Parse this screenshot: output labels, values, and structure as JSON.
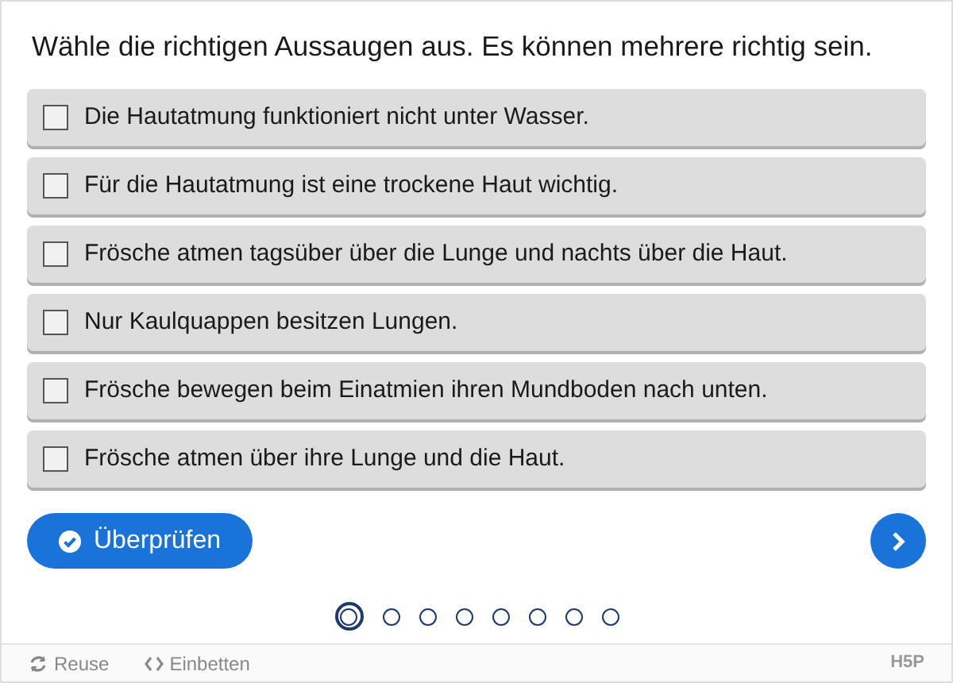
{
  "question": "Wähle die richtigen Aussaugen aus. Es können mehrere richtig sein.",
  "options": [
    {
      "label": "Die Hautatmung funktioniert nicht unter Wasser.",
      "checked": false
    },
    {
      "label": "Für die Hautatmung ist eine trockene Haut wichtig.",
      "checked": false
    },
    {
      "label": "Frösche atmen tagsüber über die Lunge und nachts über die Haut.",
      "checked": false
    },
    {
      "label": "Nur Kaulquappen besitzen Lungen.",
      "checked": false
    },
    {
      "label": "Frösche bewegen beim Einatmien ihren Mundboden nach unten.",
      "checked": false
    },
    {
      "label": "Frösche atmen über ihre Lunge und die Haut.",
      "checked": false
    }
  ],
  "check_button": "Überprüfen",
  "pages": [
    {
      "selected": true
    },
    {
      "selected": false
    },
    {
      "selected": false
    },
    {
      "selected": false
    },
    {
      "selected": false
    },
    {
      "selected": false
    },
    {
      "selected": false
    },
    {
      "selected": false
    }
  ],
  "footer": {
    "reuse": "Reuse",
    "embed": "Einbetten",
    "logo": "H5P"
  }
}
